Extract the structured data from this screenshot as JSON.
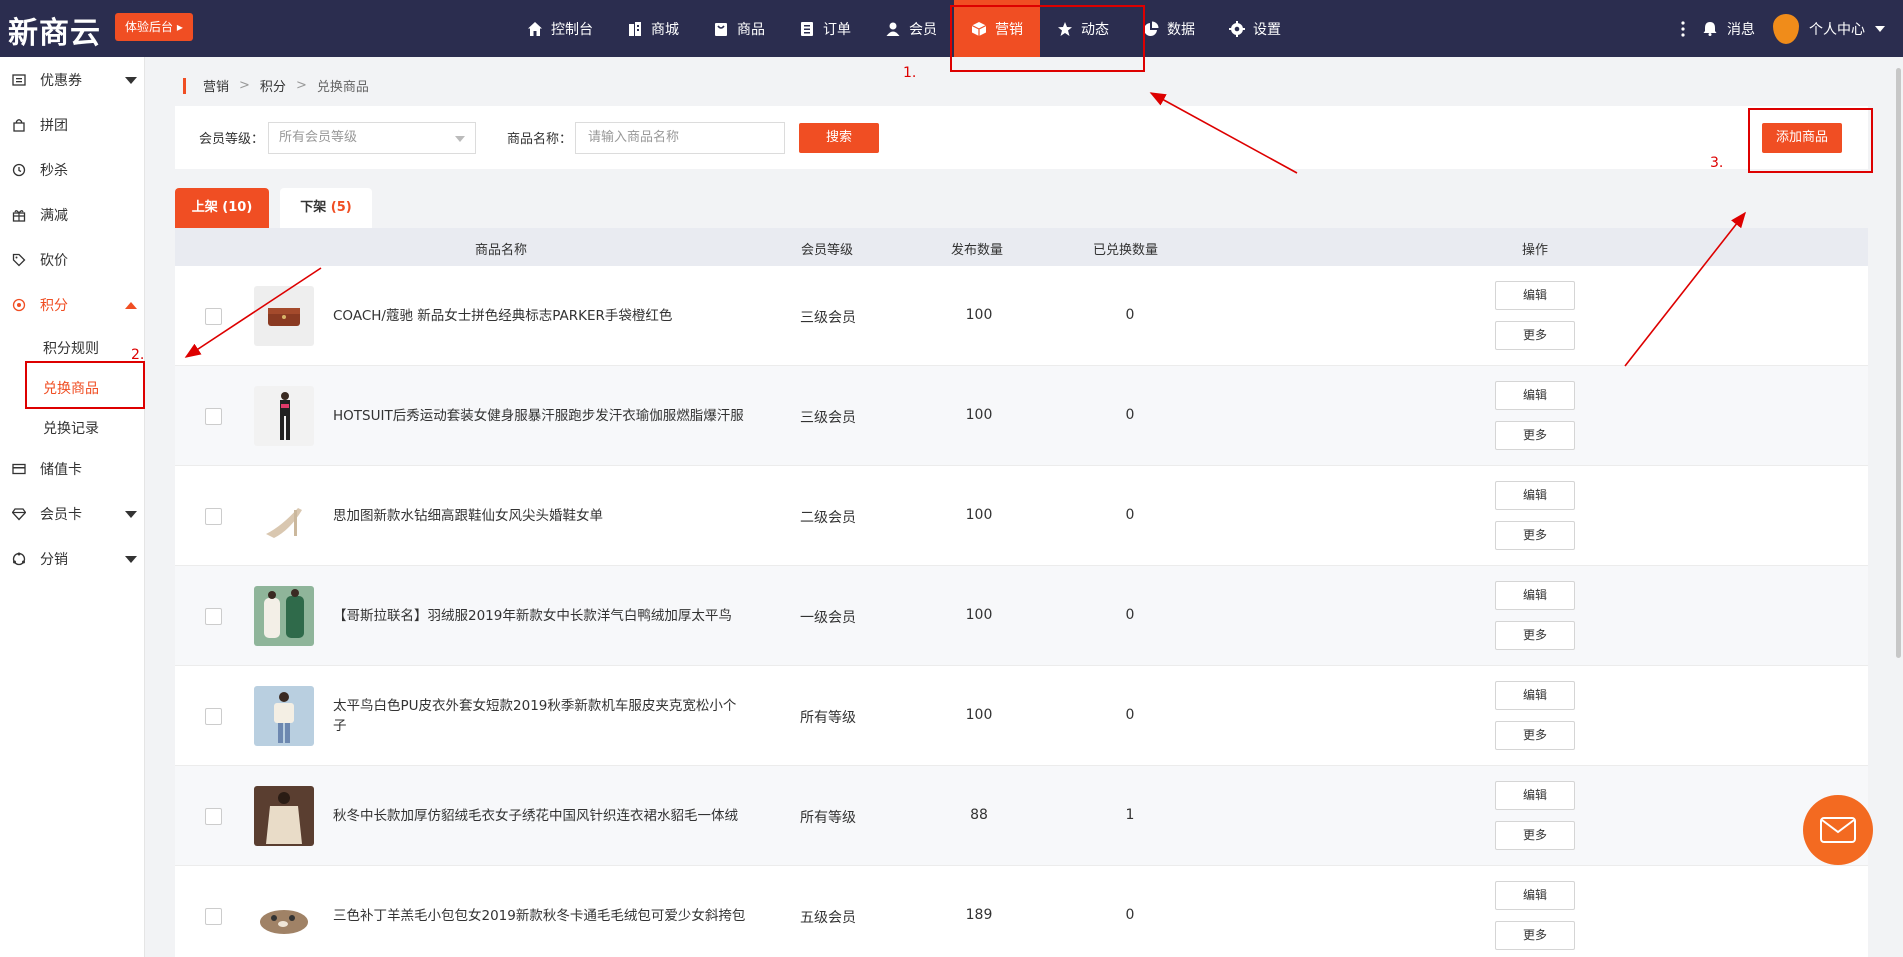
{
  "header": {
    "logo": "新商云",
    "trial_button": "体验后台 ▸",
    "nav": [
      {
        "label": "控制台",
        "icon": "home-icon"
      },
      {
        "label": "商城",
        "icon": "building-icon"
      },
      {
        "label": "商品",
        "icon": "bag-icon"
      },
      {
        "label": "订单",
        "icon": "document-icon"
      },
      {
        "label": "会员",
        "icon": "user-icon"
      },
      {
        "label": "营销",
        "icon": "box-icon",
        "active": true
      },
      {
        "label": "动态",
        "icon": "star-icon"
      },
      {
        "label": "数据",
        "icon": "pie-icon"
      },
      {
        "label": "设置",
        "icon": "gear-icon"
      }
    ],
    "messages": "消息",
    "user_center": "个人中心"
  },
  "sidebar": {
    "items": [
      {
        "label": "优惠券",
        "icon": "coupon-icon",
        "expandable": true
      },
      {
        "label": "拼团",
        "icon": "bag-icon"
      },
      {
        "label": "秒杀",
        "icon": "clock-icon"
      },
      {
        "label": "满减",
        "icon": "gift-icon"
      },
      {
        "label": "砍价",
        "icon": "tag-icon"
      },
      {
        "label": "积分",
        "icon": "points-icon",
        "expandable": true,
        "open": true
      },
      {
        "label": "储值卡",
        "icon": "card-icon"
      },
      {
        "label": "会员卡",
        "icon": "diamond-icon",
        "expandable": true
      },
      {
        "label": "分销",
        "icon": "share-icon",
        "expandable": true
      }
    ],
    "sub_items": [
      {
        "label": "积分规则"
      },
      {
        "label": "兑换商品",
        "active": true
      },
      {
        "label": "兑换记录"
      }
    ]
  },
  "breadcrumb": [
    "营销",
    "积分",
    "兑换商品"
  ],
  "search": {
    "level_label": "会员等级：",
    "level_value": "所有会员等级",
    "name_label": "商品名称：",
    "name_placeholder": "请输入商品名称",
    "search_button": "搜索",
    "add_button": "添加商品"
  },
  "tabs": {
    "on_label": "上架",
    "on_count": "(10)",
    "off_label": "下架",
    "off_count": "(5)"
  },
  "table": {
    "columns": [
      "商品名称",
      "会员等级",
      "发布数量",
      "已兑换数量",
      "操作"
    ],
    "edit_label": "编辑",
    "more_label": "更多",
    "rows": [
      {
        "name": "COACH/蔻驰 新品女士拼色经典标志PARKER手袋橙红色",
        "level": "三级会员",
        "published": "100",
        "redeemed": "0"
      },
      {
        "name": "HOTSUIT后秀运动套装女健身服暴汗服跑步发汗衣瑜伽服燃脂爆汗服",
        "level": "三级会员",
        "published": "100",
        "redeemed": "0"
      },
      {
        "name": "思加图新款水钻细高跟鞋仙女风尖头婚鞋女单",
        "level": "二级会员",
        "published": "100",
        "redeemed": "0"
      },
      {
        "name": "【哥斯拉联名】羽绒服2019年新款女中长款洋气白鸭绒加厚太平鸟",
        "level": "一级会员",
        "published": "100",
        "redeemed": "0"
      },
      {
        "name": "太平鸟白色PU皮衣外套女短款2019秋季新款机车服皮夹克宽松小个子",
        "level": "所有等级",
        "published": "100",
        "redeemed": "0"
      },
      {
        "name": "秋冬中长款加厚仿貂绒毛衣女子绣花中国风针织连衣裙水貂毛一体绒",
        "level": "所有等级",
        "published": "88",
        "redeemed": "1"
      },
      {
        "name": "三色补丁羊羔毛小包包女2019新款秋冬卡通毛毛绒包可爱少女斜挎包",
        "level": "五级会员",
        "published": "189",
        "redeemed": "0"
      }
    ]
  },
  "annotations": [
    "1.",
    "2.",
    "3."
  ],
  "colors": {
    "accent": "#f04e23",
    "header_bg": "#2b2d4f",
    "annotation": "#dd0000"
  }
}
